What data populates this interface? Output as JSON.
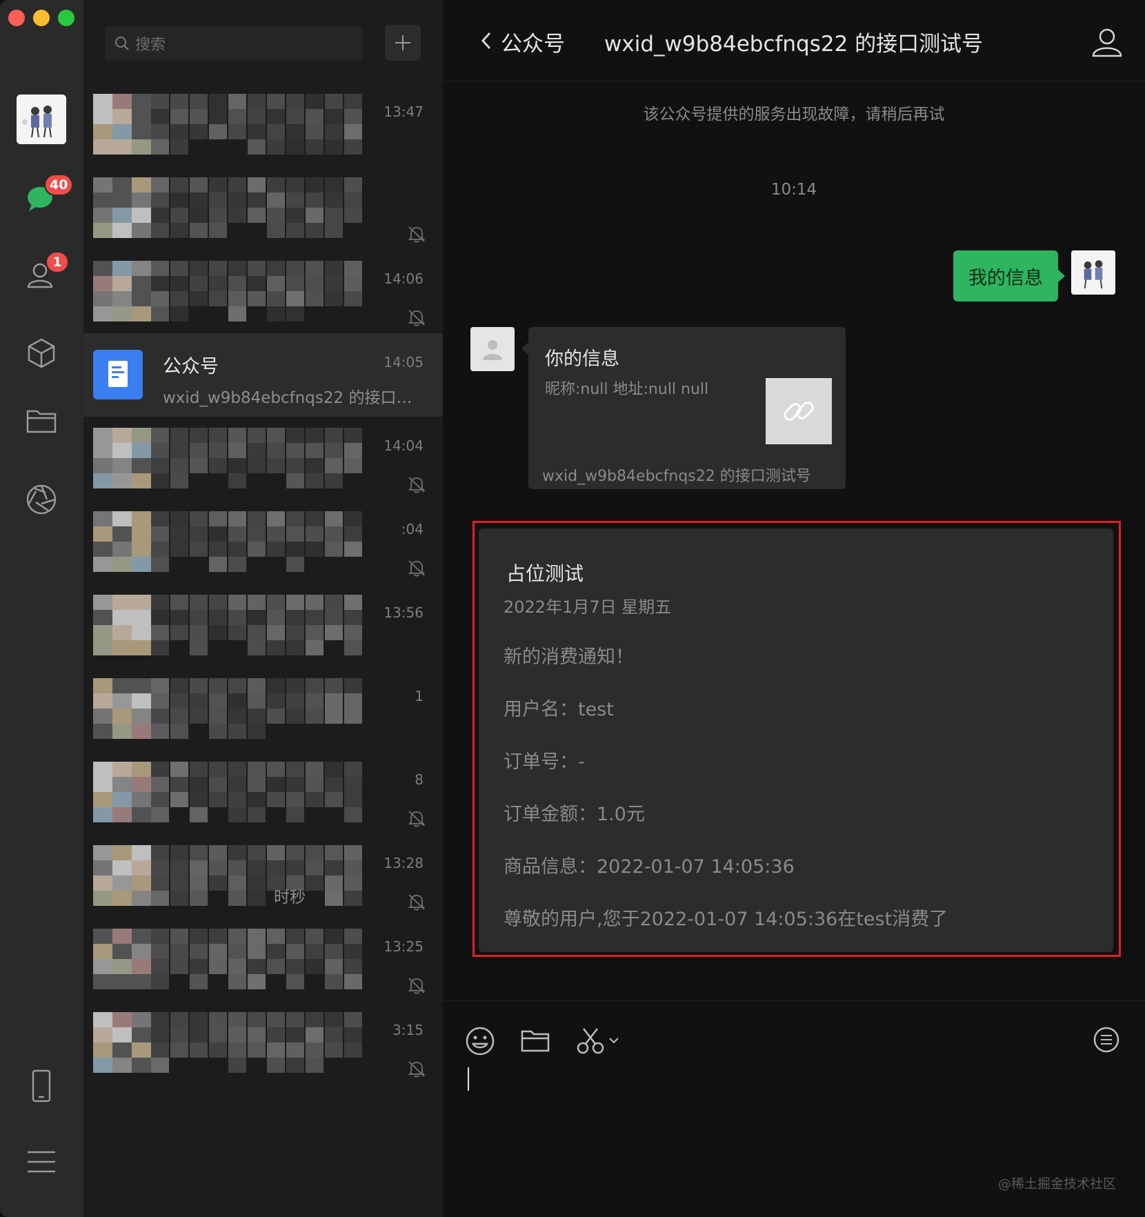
{
  "window": {
    "controls": [
      "close",
      "minimize",
      "maximize"
    ]
  },
  "rail": {
    "chats_badge": "40",
    "contacts_badge": "1",
    "icons": [
      "avatar",
      "chat-icon",
      "contacts-icon",
      "cube-icon",
      "folder-icon",
      "aperture-icon",
      "phone-icon",
      "menu-icon"
    ]
  },
  "list": {
    "search_placeholder": "搜索",
    "items": [
      {
        "time": "13:47",
        "muted": false
      },
      {
        "time": "",
        "muted": true
      },
      {
        "time": "14:06",
        "muted": true
      },
      {
        "name": "公众号",
        "time": "14:05",
        "preview": "wxid_w9b84ebcfnqs22 的接口测试号",
        "muted": false,
        "active": true
      },
      {
        "time": "14:04",
        "muted": true
      },
      {
        "time": ":04",
        "muted": true
      },
      {
        "time": "13:56",
        "muted": false
      },
      {
        "time": "1",
        "muted": false
      },
      {
        "time": "8",
        "muted": true
      },
      {
        "time": "13:28",
        "muted": true,
        "preview_fragment": "时秒"
      },
      {
        "time": "13:25",
        "muted": true
      },
      {
        "time": "3:15",
        "muted": true
      }
    ]
  },
  "header": {
    "folder": "公众号",
    "title": "wxid_w9b84ebcfnqs22 的接口测试号"
  },
  "messages": {
    "system_notice": "该公众号提供的服务出现故障，请稍后再试",
    "time_separator": "10:14",
    "outgoing": "我的信息",
    "link_card": {
      "title": "你的信息",
      "description": "昵称:null  地址:null null",
      "source": "wxid_w9b84ebcfnqs22 的接口测试号"
    },
    "template_card": {
      "title": "占位测试",
      "date": "2022年1月7日 星期五",
      "lines": [
        "新的消费通知！",
        "用户名：test",
        "订单号：-",
        "订单金额：1.0元",
        "商品信息：2022-01-07 14:05:36",
        "尊敬的用户,您于2022-01-07 14:05:36在test消费了"
      ]
    }
  },
  "composer": {
    "tools": [
      "emoji-icon",
      "folder-icon",
      "scissors-icon",
      "chevron-down-icon",
      "chat-history-icon"
    ]
  },
  "watermark": "@稀土掘金技术社区",
  "colors": {
    "accent_green": "#2fb45f",
    "badge_red": "#f24b4b",
    "highlight_red": "#e0202a",
    "bg_dark": "#111111"
  }
}
